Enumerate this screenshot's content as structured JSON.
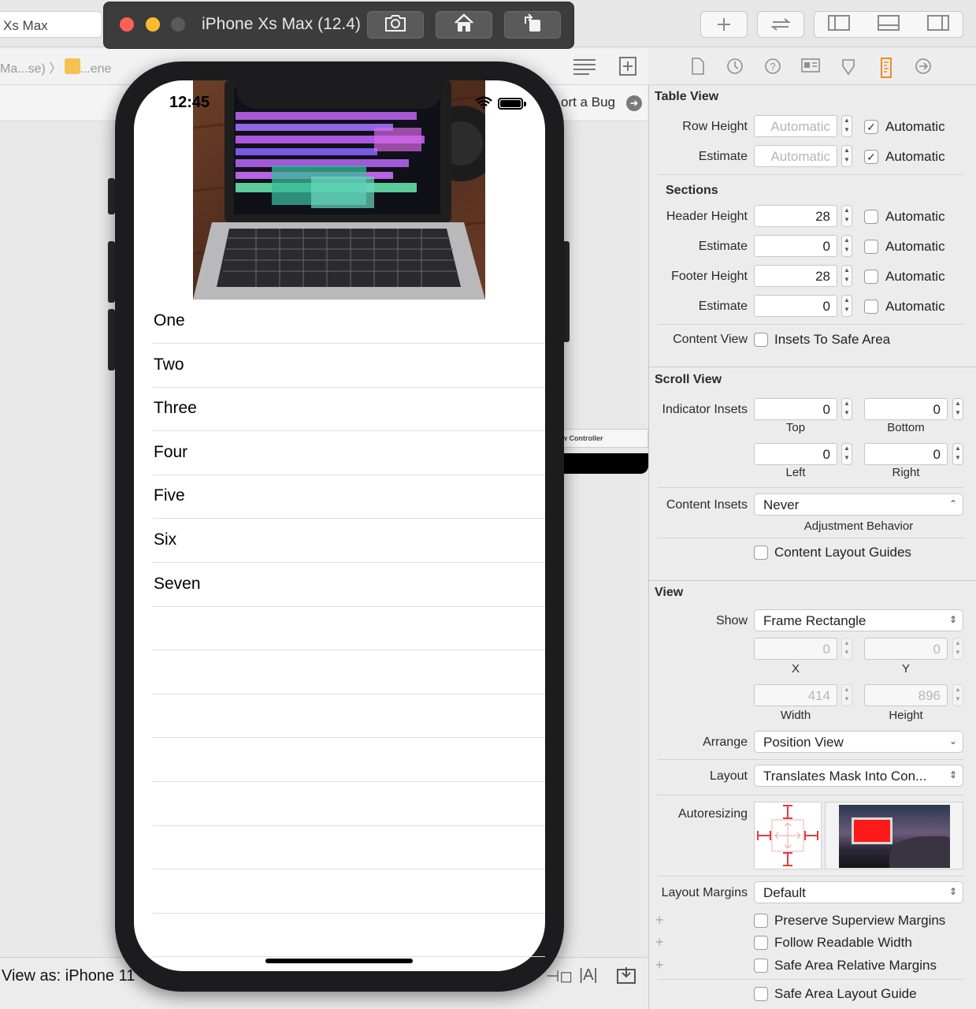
{
  "xcode": {
    "scheme": "Xs Max",
    "jump_path": "Ma...se)  〉  Ex...ene",
    "report_bug": "ort a Bug",
    "vc_label": "w Controller",
    "view_as": "View as: iPhone 11"
  },
  "simulator": {
    "title": "iPhone Xs Max (12.4)",
    "status_time": "12:45"
  },
  "table": {
    "rows": [
      "One",
      "Two",
      "Three",
      "Four",
      "Five",
      "Six",
      "Seven"
    ]
  },
  "icons": {
    "toolbar": [
      "plus-icon",
      "swap-icon",
      "left-panel-icon",
      "bottom-panel-icon",
      "right-panel-icon"
    ],
    "inspector_tabs": [
      "file-icon",
      "history-icon",
      "help-icon",
      "identity-icon",
      "attributes-icon",
      "size-icon",
      "connections-icon"
    ],
    "accent": "#f08a24"
  },
  "inspector": {
    "table_view": {
      "title": "Table View",
      "row_height_label": "Row Height",
      "row_height_value": "Automatic",
      "row_height_auto": "Automatic",
      "estimate_label": "Estimate",
      "estimate_value": "Automatic",
      "estimate_auto": "Automatic",
      "sections_title": "Sections",
      "header_height_label": "Header Height",
      "header_height_value": "28",
      "header_est_label": "Estimate",
      "header_est_value": "0",
      "footer_height_label": "Footer Height",
      "footer_height_value": "28",
      "footer_est_label": "Estimate",
      "footer_est_value": "0",
      "auto_label": "Automatic",
      "content_view_label": "Content View",
      "insets_safe_area": "Insets To Safe Area"
    },
    "scroll_view": {
      "title": "Scroll View",
      "indicator_insets_label": "Indicator Insets",
      "top_value": "0",
      "top_caption": "Top",
      "bottom_value": "0",
      "bottom_caption": "Bottom",
      "left_value": "0",
      "left_caption": "Left",
      "right_value": "0",
      "right_caption": "Right",
      "content_insets_label": "Content Insets",
      "content_insets_value": "Never",
      "adjustment_behavior": "Adjustment Behavior",
      "content_layout_guides": "Content Layout Guides"
    },
    "view": {
      "title": "View",
      "show_label": "Show",
      "show_value": "Frame Rectangle",
      "x_value": "0",
      "x_caption": "X",
      "y_value": "0",
      "y_caption": "Y",
      "width_value": "414",
      "width_caption": "Width",
      "height_value": "896",
      "height_caption": "Height",
      "arrange_label": "Arrange",
      "arrange_value": "Position View",
      "layout_label": "Layout",
      "layout_value": "Translates Mask Into Con...",
      "autoresizing_label": "Autoresizing",
      "layout_margins_label": "Layout Margins",
      "layout_margins_value": "Default",
      "preserve_superview": "Preserve Superview Margins",
      "follow_readable": "Follow Readable Width",
      "safe_area_relative": "Safe Area Relative Margins",
      "safe_area_guide": "Safe Area Layout Guide"
    }
  }
}
